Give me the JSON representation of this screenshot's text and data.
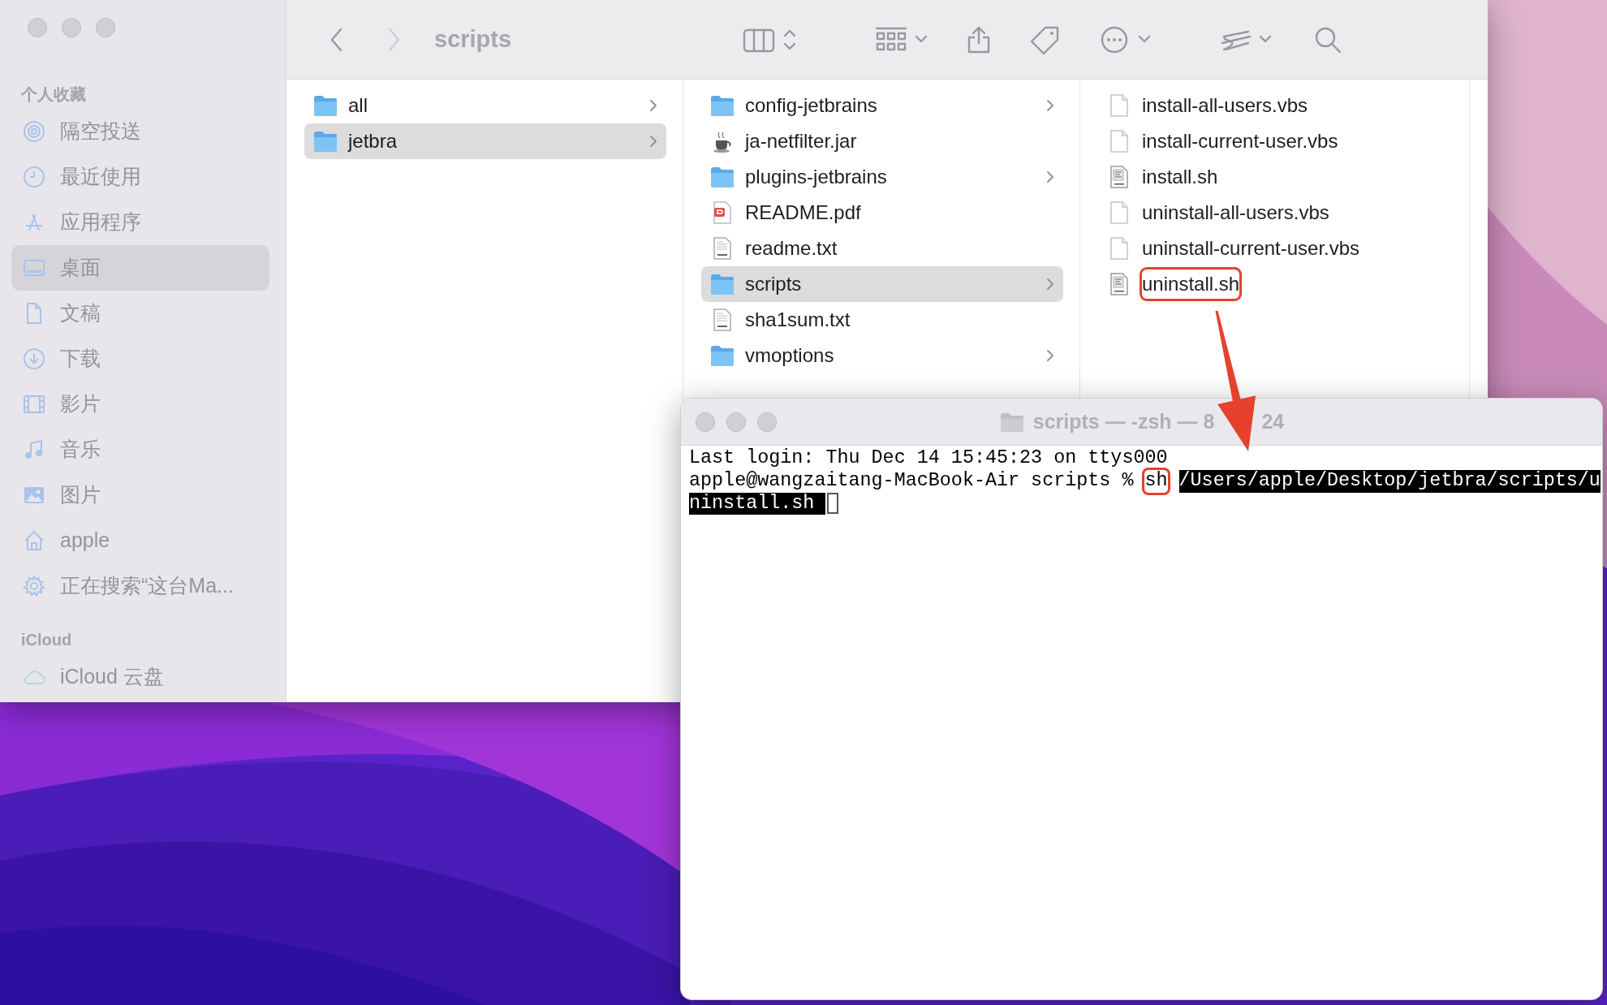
{
  "finder": {
    "toolbar": {
      "title": "scripts"
    },
    "sidebar": [
      {
        "heading": "个人收藏",
        "items": [
          {
            "label": "隔空投送",
            "selected": false
          },
          {
            "label": "最近使用",
            "selected": false
          },
          {
            "label": "应用程序",
            "selected": false
          },
          {
            "label": "桌面",
            "selected": true
          },
          {
            "label": "文稿",
            "selected": false
          },
          {
            "label": "下载",
            "selected": false
          },
          {
            "label": "影片",
            "selected": false
          },
          {
            "label": "音乐",
            "selected": false
          },
          {
            "label": "图片",
            "selected": false
          },
          {
            "label": "apple",
            "selected": false
          },
          {
            "label": "正在搜索“这台Ma...",
            "selected": false
          }
        ]
      },
      {
        "heading": "iCloud",
        "items": [
          {
            "label": "iCloud 云盘",
            "selected": false
          }
        ]
      }
    ],
    "columns": [
      {
        "items": [
          {
            "name": "all",
            "kind": "folder",
            "selected": false,
            "marked": false
          },
          {
            "name": "jetbra",
            "kind": "folder",
            "selected": true,
            "marked": false
          }
        ]
      },
      {
        "items": [
          {
            "name": "config-jetbrains",
            "kind": "folder",
            "selected": false,
            "marked": false
          },
          {
            "name": "ja-netfilter.jar",
            "kind": "jar",
            "selected": false,
            "marked": false
          },
          {
            "name": "plugins-jetbrains",
            "kind": "folder",
            "selected": false,
            "marked": false
          },
          {
            "name": "README.pdf",
            "kind": "pdf",
            "selected": false,
            "marked": false
          },
          {
            "name": "readme.txt",
            "kind": "txt",
            "selected": false,
            "marked": false
          },
          {
            "name": "scripts",
            "kind": "folder",
            "selected": true,
            "marked": false
          },
          {
            "name": "sha1sum.txt",
            "kind": "txt",
            "selected": false,
            "marked": false
          },
          {
            "name": "vmoptions",
            "kind": "folder",
            "selected": false,
            "marked": false
          }
        ]
      },
      {
        "items": [
          {
            "name": "install-all-users.vbs",
            "kind": "blank",
            "selected": false,
            "marked": false
          },
          {
            "name": "install-current-user.vbs",
            "kind": "blank",
            "selected": false,
            "marked": false
          },
          {
            "name": "install.sh",
            "kind": "shell",
            "selected": false,
            "marked": false
          },
          {
            "name": "uninstall-all-users.vbs",
            "kind": "blank",
            "selected": false,
            "marked": false
          },
          {
            "name": "uninstall-current-user.vbs",
            "kind": "blank",
            "selected": false,
            "marked": false
          },
          {
            "name": "uninstall.sh",
            "kind": "shell",
            "selected": false,
            "marked": true
          }
        ]
      }
    ]
  },
  "terminal": {
    "title_parts": [
      "scripts — -zsh — 8",
      "24"
    ],
    "lines": [
      {
        "cursor": false,
        "segments": [
          {
            "text": "Last login: Thu Dec 14 15:45:23 on ttys000",
            "selected": false,
            "marked": false
          }
        ]
      },
      {
        "cursor": false,
        "segments": [
          {
            "text": "apple@wangzaitang-MacBook-Air scripts % ",
            "selected": false,
            "marked": false
          },
          {
            "text": "sh",
            "selected": false,
            "marked": true
          },
          {
            "text": "/Users/apple/Desktop/jetbra/scripts/u",
            "selected": true,
            "marked": false
          }
        ]
      },
      {
        "cursor": true,
        "segments": [
          {
            "text": "ninstall.sh ",
            "selected": true,
            "marked": false
          }
        ]
      }
    ]
  }
}
